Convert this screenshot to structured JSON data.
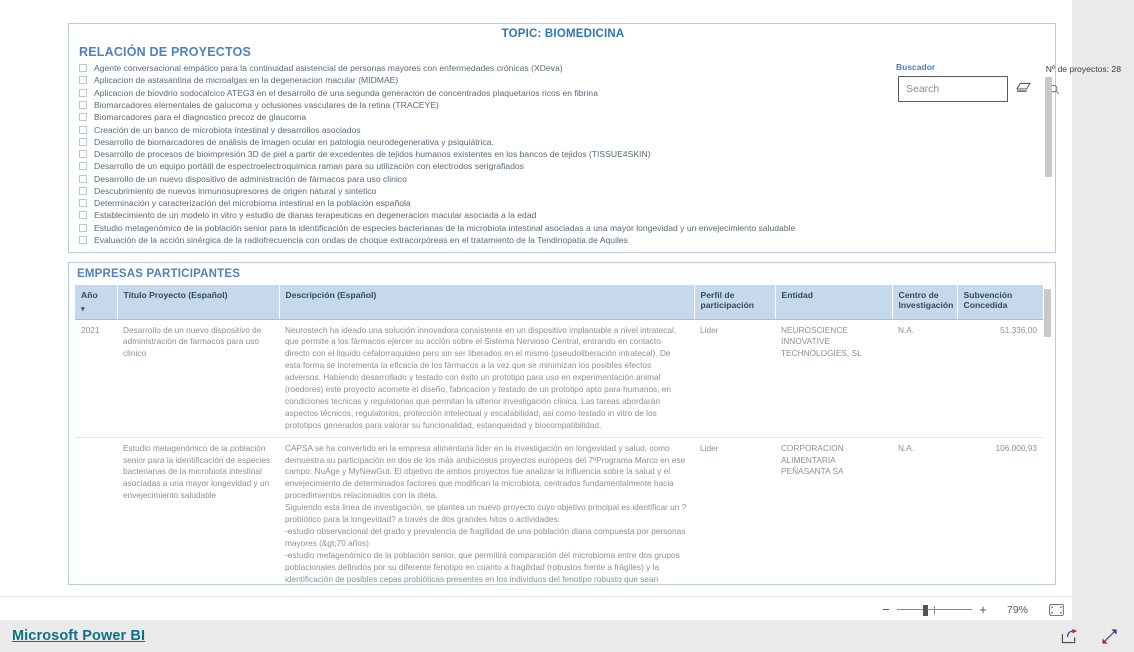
{
  "report": {
    "topic_title": "TOPIC: BIOMEDICINA",
    "brand": "Microsoft Power BI"
  },
  "projects_panel": {
    "heading": "RELACIÓN DE PROYECTOS",
    "count_label": "Nº de proyectos: 28",
    "items": [
      "Agente conversacional empático para la continuidad asistencial de personas mayores con enfermedades crónicas (XDeva)",
      "Aplicacion de astasantina de microalgas en la degeneracion macular (MIDMAE)",
      "Aplicacion de biovdrio sodocalcico ATEG3 en el desarrollo de una segunda generacion de concentrados plaquetarios ricos en fibrina",
      "Biomarcadores elementales de galucoma y oclusiones vasculares de la retina (TRACEYE)",
      "Biomarcadores para el diagnostico precoz de glaucoma",
      "Creación de un banco de microbiota intestinal y desarrollos asociados",
      "Desarrollo de biomarcadores de análisis de imagen ocular en patologia neurodegenerativa y psiquiátrica.",
      "Desarrollo de procesos de bioimpresión 3D de piel a partir de excedentes de tejidos humanos existentes en los bancos de tejidos (TISSUE4SKIN)",
      "Desarrollo de un equipo portátil de espectroelectroquimica raman para su utilización con electrodos serigrafiados",
      "Desarrollo de un nuevo dispositivo de administración de fármacos para uso clinico",
      "Descubrimiento de nuevos inmunosupresores de origen natural y sintetico",
      "Determinación y caracterización del microbioma intestinal en la población española",
      "Establecimiento de un modelo in vitro y estudio de dianas terapeuticas en degeneracion macular asociada a la edad",
      "Estudio metagenómico de la población senior para la identificación de especies bacterianas de la microbiota intestinal asociadas a una mayor longevidad y un envejecimiento saludable",
      "Evaluación de la acción sinérgica de la radiofrecuencia con ondas de choque extracorpóreas en el tratamiento de la Tendinopatia de Aquiles"
    ]
  },
  "search": {
    "label": "Buscador",
    "placeholder": "Search",
    "value": "",
    "search_icon": "search-icon",
    "eraser_icon": "eraser-icon"
  },
  "empresas_panel": {
    "heading": "EMPRESAS PARTICIPANTES",
    "columns": [
      "Año",
      "Titulo Proyecto (Español)",
      "Descripción (Español)",
      "Perfil de participación",
      "Entidad",
      "Centro de Investigación",
      "Subvención Concedida"
    ],
    "sort_caret": "▾",
    "rows": [
      {
        "year": "2021",
        "title": "Desarrollo de un nuevo dispositivo de administración de farmacos para uso clinico",
        "description": "Neurostech ha ideado una solución innovadora consistente en un dispositivo implantable a nivel intratecal, que permite a los fármacos ejercer su acción sobre el Sistema Nervioso Central, entrando en contacto directo con el liquido cefalorraquideo pero sin ser liberados en el mismo (pseudoliberación intratecal). De esta forma se incrementa la eficacia de los fármacos a la vez que se minimizan los posibles efectos adversos. Habiendo desarrollado y testado con éxito un prototipo para uso en experimentación animal (roedores) este proyecto acomete el diseño, fabricacion y testado de un prototipo apto para humanos, en condiciones tecnicas y regulatorias que permitan la ulterior investigación clinica. Las tareas abordarán aspectos técnicos, regulatorios, protección intelectual y escalabilidad, asi como testado in vitro de los prototipos generados para valorar su funcionalidad, estanqueidad y biocompatibilidad.",
        "profile": "Lider",
        "entity": "NEUROSCIENCE INNOVATIVE TECHNOLOGIES, SL",
        "center": "N.A.",
        "grant": "51.336,00"
      },
      {
        "year": "",
        "title": "Estudio metagenómico de la población senior para la identificación de especies bacterianas de la microbiota intestinal asociadas a una mayor longevidad y un envejecimiento saludable",
        "description": "CAPSA se ha convertido en la empresa alimentaria lider en la investigación en longevidad y salud, como demuestra su participación en dos de los más ambiciosos proyectos europeos del 7ºPrograma Marco en ese campo: NuAge y MyNewGut. El objetivo de ambos proyectos fue analizar la influencia sobre la salud y el envejecimiento de determinados factores que modifican la microbiota, centrados fundamentalmente hacia procedimientos relacionados con la dieta.\nSiguiendo esta linea de investigación, se plantea un nuevo proyecto cuyo objetivo principal es identificar un ?probiótico para la longevidad? a través de dos grandes hitos o actividades:\n-estudio observacional del grado y prevalencia de fragilidad de una población diana compuesta por personas mayores (&gt;70 años)\n-estudio metagenómico de la población senior, que permitirá comparación del microbioma entre dos grupos poblacionales definidos por su diferente fenotipo en cuanto a fragilidad (robustos frente a frágiles) y la identificación de posibles cepas probióticas presentes en los individuos del fenotipo robusto que sean posteriormente aisladas, caracterizadas y definan un nuevo probiótico asociado a un envejecimiento",
        "profile": "Lider",
        "entity": "CORPORACION ALIMENTARIA PEÑASANTA SA",
        "center": "N.A.",
        "grant": "106.000,93"
      }
    ]
  },
  "report_bar": {
    "zoom_minus": "−",
    "zoom_plus": "+",
    "zoom_value": "79%",
    "fit_icon": "fit-to-page-icon"
  },
  "footer": {
    "share_icon": "share-icon",
    "fullscreen_icon": "fullscreen-icon"
  },
  "colors": {
    "accent_blue": "#4f81bd",
    "topic_blue": "#2e75b6",
    "header_fill": "#c6d9ec",
    "brand_teal": "#0b7285",
    "page_bg": "#eaeaea"
  }
}
